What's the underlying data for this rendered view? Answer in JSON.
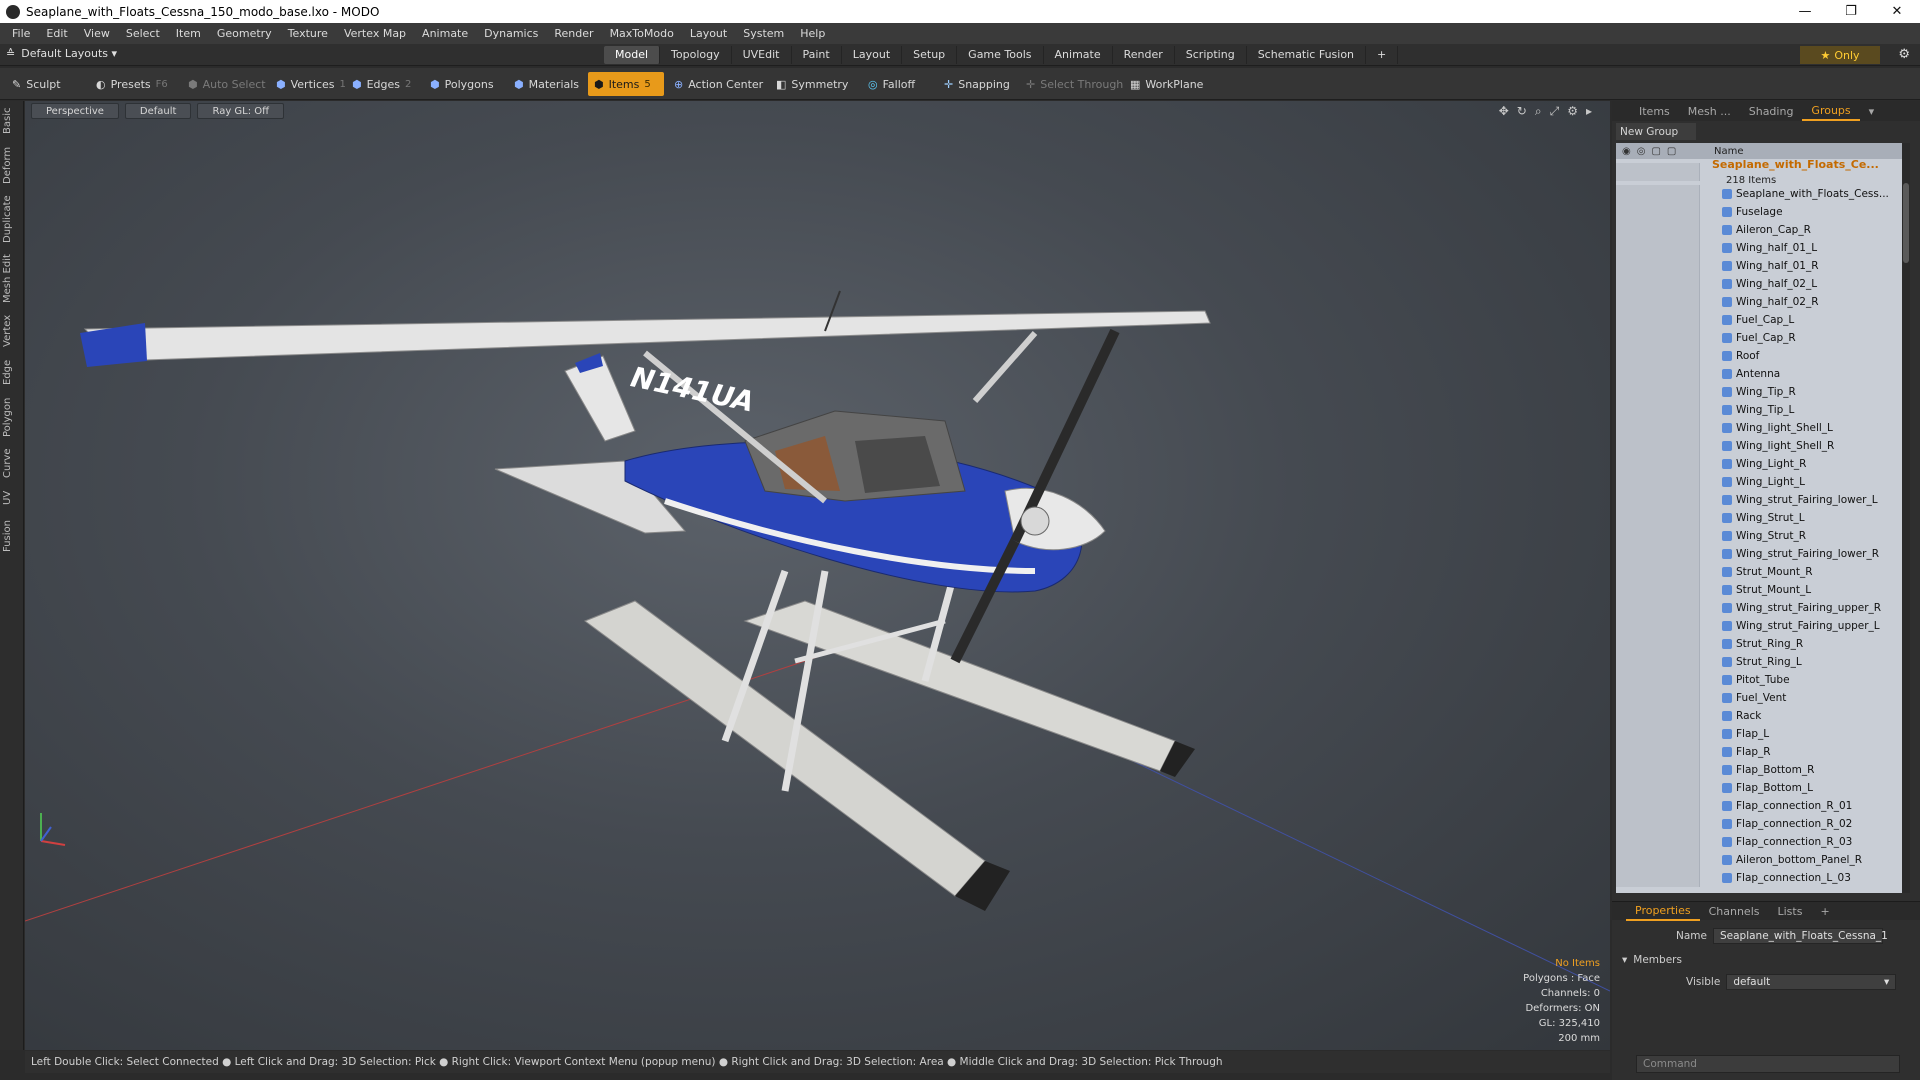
{
  "window": {
    "title": "Seaplane_with_Floats_Cessna_150_modo_base.lxo - MODO",
    "controls": [
      "—",
      "❐",
      "✕"
    ]
  },
  "menu": [
    "File",
    "Edit",
    "View",
    "Select",
    "Item",
    "Geometry",
    "Texture",
    "Vertex Map",
    "Animate",
    "Dynamics",
    "Render",
    "MaxToModo",
    "Layout",
    "System",
    "Help"
  ],
  "layout": {
    "selector": "Default Layouts ▾",
    "tabs": [
      "Model",
      "Topology",
      "UVEdit",
      "Paint",
      "Layout",
      "Setup",
      "Game Tools",
      "Animate",
      "Render",
      "Scripting",
      "Schematic Fusion",
      "+"
    ],
    "active_tab": "Model",
    "only_label": "Only"
  },
  "toolbar": {
    "sculpt": "Sculpt",
    "presets": "Presets",
    "presets_key": "F6",
    "auto_select": "Auto Select",
    "vertices": "Vertices",
    "vertices_key": "1",
    "edges": "Edges",
    "edges_key": "2",
    "polygons": "Polygons",
    "materials": "Materials",
    "items": "Items",
    "items_key": "5",
    "action_center": "Action Center",
    "symmetry": "Symmetry",
    "falloff": "Falloff",
    "snapping": "Snapping",
    "select_through": "Select Through",
    "workplane": "WorkPlane"
  },
  "left_tabs": [
    "Basic",
    "Deform",
    "Duplicate",
    "Mesh Edit",
    "Vertex",
    "Edge",
    "Polygon",
    "Curve",
    "UV",
    "Fusion"
  ],
  "viewport": {
    "view": "Perspective",
    "shading": "Default",
    "raygl": "Ray GL: Off",
    "registration": "N141UA",
    "info": {
      "selection": "No Items",
      "polygons": "Polygons : Face",
      "channels": "Channels: 0",
      "deformers": "Deformers: ON",
      "gl": "GL: 325,410",
      "scale": "200 mm"
    }
  },
  "status": "Left Double Click: Select Connected ● Left Click and Drag: 3D Selection: Pick ● Right Click: Viewport Context Menu (popup menu) ● Right Click and Drag: 3D Selection: Area ● Middle Click and Drag: 3D Selection: Pick Through",
  "panel": {
    "tabs": [
      "Items",
      "Mesh ...",
      "Shading",
      "Groups"
    ],
    "active_tab": "Groups",
    "new_group": "New Group",
    "column_name": "Name",
    "root": "Seaplane_with_Floats_Ce...",
    "root_count": "218 Items",
    "items": [
      "Seaplane_with_Floats_Cess...",
      "Fuselage",
      "Aileron_Cap_R",
      "Wing_half_01_L",
      "Wing_half_01_R",
      "Wing_half_02_L",
      "Wing_half_02_R",
      "Fuel_Cap_L",
      "Fuel_Cap_R",
      "Roof",
      "Antenna",
      "Wing_Tip_R",
      "Wing_Tip_L",
      "Wing_light_Shell_L",
      "Wing_light_Shell_R",
      "Wing_Light_R",
      "Wing_Light_L",
      "Wing_strut_Fairing_lower_L",
      "Wing_Strut_L",
      "Wing_Strut_R",
      "Wing_strut_Fairing_lower_R",
      "Strut_Mount_R",
      "Strut_Mount_L",
      "Wing_strut_Fairing_upper_R",
      "Wing_strut_Fairing_upper_L",
      "Strut_Ring_R",
      "Strut_Ring_L",
      "Pitot_Tube",
      "Fuel_Vent",
      "Rack",
      "Flap_L",
      "Flap_R",
      "Flap_Bottom_R",
      "Flap_Bottom_L",
      "Flap_connection_R_01",
      "Flap_connection_R_02",
      "Flap_connection_R_03",
      "Aileron_bottom_Panel_R",
      "Flap_connection_L_03"
    ]
  },
  "properties": {
    "tabs": [
      "Properties",
      "Channels",
      "Lists",
      "+"
    ],
    "active_tab": "Properties",
    "name_label": "Name",
    "name_value": "Seaplane_with_Floats_Cessna_1",
    "members": "Members",
    "visible_label": "Visible",
    "visible_value": "default",
    "command_placeholder": "Command"
  },
  "colors": {
    "accent": "#f0a020",
    "fuselage_blue": "#2a45b8",
    "float_white": "#d8d8d4"
  }
}
